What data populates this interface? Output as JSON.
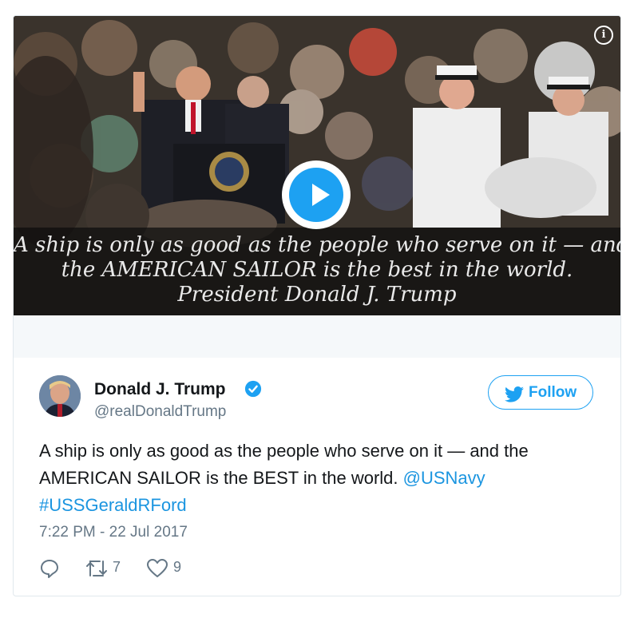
{
  "media": {
    "caption_lines": [
      "A ship is only as good as the people who serve on it — and",
      "the AMERICAN SAILOR is the best in the world.",
      "President Donald J. Trump"
    ],
    "play_icon": "play-icon",
    "info_icon": "info-icon",
    "info_glyph": "i"
  },
  "author": {
    "name": "Donald J. Trump",
    "handle": "@realDonaldTrump",
    "verified_icon": "verified-badge-icon"
  },
  "follow": {
    "label": "Follow",
    "icon": "twitter-bird-icon"
  },
  "tweet": {
    "text_part1": "A ship is only as good as the people who serve on it — and the AMERICAN SAILOR is the BEST in the world. ",
    "mention": "@USNavy",
    "hashtag": "#USSGeraldRFord",
    "timestamp": "7:22 PM - 22 Jul 2017"
  },
  "actions": {
    "reply_icon": "reply-icon",
    "retweet_icon": "retweet-icon",
    "retweet_count": "7",
    "like_icon": "heart-icon",
    "like_count": "9"
  },
  "colors": {
    "accent": "#1da1f2",
    "link": "#1b95e0",
    "text": "#14171a",
    "muted": "#657786",
    "border": "#e1e8ed"
  }
}
